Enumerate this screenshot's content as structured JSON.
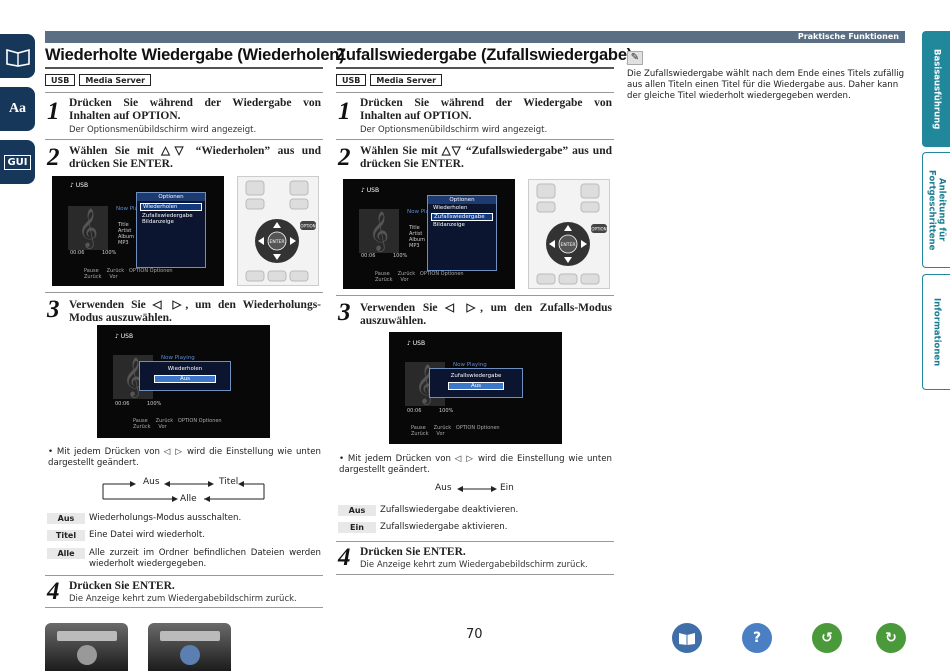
{
  "header": {
    "section": "Praktische Funktionen"
  },
  "left_tabs": [
    "book-icon",
    "Aa",
    "GUI"
  ],
  "right_tabs": [
    {
      "label": "Basisausführung",
      "active": true
    },
    {
      "label": "Anleitung für Fortgeschrittene",
      "active": false
    },
    {
      "label": "Informationen",
      "active": false
    }
  ],
  "repeat": {
    "title": "Wiederholte Wiedergabe (Wiederholen)",
    "tags": [
      "USB",
      "Media Server"
    ],
    "step1_title": "Drücken Sie während der Wiedergabe von Inhalten auf OPTION.",
    "step1_sub": "Der Optionsmenübildschirm wird angezeigt.",
    "step2_title": "Wählen Sie mit △▽ “Wiederholen” aus und drücken Sie ENTER.",
    "step3_title": "Verwenden Sie ◁ ▷, um den Wiederholungs-Modus auszuwählen.",
    "note": "Mit jedem Drücken von ◁ ▷ wird die Einstellung wie unten dargestellt geändert.",
    "cycle": [
      "Aus",
      "Titel",
      "Alle"
    ],
    "options": [
      {
        "label": "Aus",
        "desc": "Wiederholungs-Modus ausschalten."
      },
      {
        "label": "Titel",
        "desc": "Eine Datei wird wiederholt."
      },
      {
        "label": "Alle",
        "desc": "Alle zurzeit im Ordner befindlichen Dateien werden wiederholt wiedergegeben."
      }
    ],
    "step4_title": "Drücken Sie ENTER.",
    "step4_sub": "Die Anzeige kehrt zum Wiedergabebildschirm zurück."
  },
  "shuffle": {
    "title": "Zufallswiedergabe (Zufallswiedergabe)",
    "tags": [
      "USB",
      "Media Server"
    ],
    "step1_title": "Drücken Sie während der Wiedergabe von Inhalten auf OPTION.",
    "step1_sub": "Der Optionsmenübildschirm wird angezeigt.",
    "step2_title": "Wählen Sie mit △▽ “Zufallswiedergabe” aus und drücken Sie ENTER.",
    "step3_title": "Verwenden Sie ◁ ▷, um den Zufalls-Modus auszuwählen.",
    "note": "Mit jedem Drücken von ◁ ▷ wird die Einstellung wie unten dargestellt geändert.",
    "cycle": [
      "Aus",
      "Ein"
    ],
    "options": [
      {
        "label": "Aus",
        "desc": "Zufallswiedergabe deaktivieren."
      },
      {
        "label": "Ein",
        "desc": "Zufallswiedergabe aktivieren."
      }
    ],
    "step4_title": "Drücken Sie ENTER.",
    "step4_sub": "Die Anzeige kehrt zum Wiedergabebildschirm zurück."
  },
  "info_note": "Die Zufallswiedergabe wählt nach dem Ende eines Titels zufällig aus allen Titeln einen Titel für die Wiedergabe aus. Daher kann der gleiche Titel wiederholt wiedergegeben werden.",
  "screens": {
    "source": "USB",
    "now_playing": "Now Playing",
    "options_title": "Optionen",
    "options": [
      "Wiederholen",
      "Zufallswiedergabe",
      "Bildanzeige"
    ],
    "meta": [
      "Title",
      "Artist",
      "Album",
      "MP3"
    ],
    "time": "00:06",
    "percent": "100%",
    "controls": [
      "Pause",
      "Zurück",
      "Zurück",
      "Vor",
      "Optionen"
    ],
    "repeat_popup_title": "Wiederholen",
    "repeat_popup_value": "Aus",
    "shuffle_popup_title": "Zufallswiedergabe",
    "shuffle_popup_value": "Aus",
    "tiny_option_key": "OPTION",
    "remote_enter": "ENTER",
    "remote_option": "OPTION"
  },
  "footer": {
    "page_number": "70",
    "nav_icons": [
      "book-icon",
      "help-icon",
      "back-icon",
      "forward-icon"
    ]
  }
}
